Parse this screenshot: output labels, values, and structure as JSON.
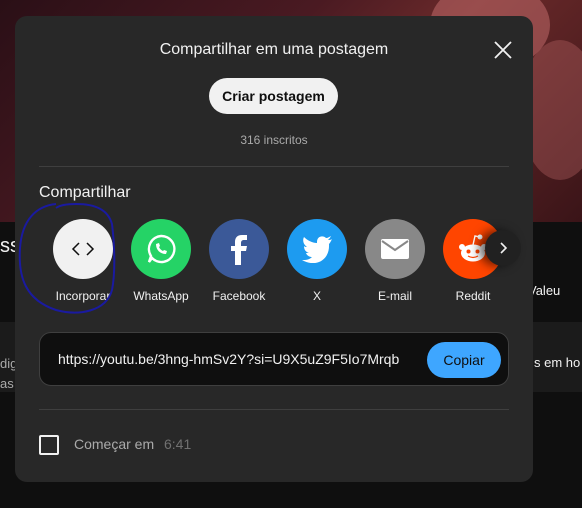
{
  "background": {
    "left_fragment": "ss",
    "text_fragment_1": "dig",
    "text_fragment_2": "as",
    "right_fragment_1": "Valeu",
    "right_fragment_2": "s em ho"
  },
  "modal": {
    "title": "Compartilhar em uma postagem",
    "create_post_label": "Criar postagem",
    "subscribers": "316 inscritos",
    "share_heading": "Compartilhar",
    "share_targets": [
      {
        "label": "Incorporar",
        "icon": "embed-icon",
        "color": "#f1f1f1"
      },
      {
        "label": "WhatsApp",
        "icon": "whatsapp-icon",
        "color": "#25d366"
      },
      {
        "label": "Facebook",
        "icon": "facebook-icon",
        "color": "#3b5998"
      },
      {
        "label": "X",
        "icon": "twitter-bird-icon",
        "color": "#1d9bf0"
      },
      {
        "label": "E-mail",
        "icon": "email-icon",
        "color": "#888888"
      },
      {
        "label": "Reddit",
        "icon": "reddit-icon",
        "color": "#ff4500"
      }
    ],
    "url": "https://youtu.be/3hng-hmSv2Y?si=U9X5uZ9F5Io7Mrqb",
    "copy_label": "Copiar",
    "start_at_label": "Começar em",
    "start_at_time": "6:41"
  },
  "colors": {
    "accent": "#3ea6ff",
    "modal_bg": "#282828",
    "annotation": "#1a1aa0"
  }
}
